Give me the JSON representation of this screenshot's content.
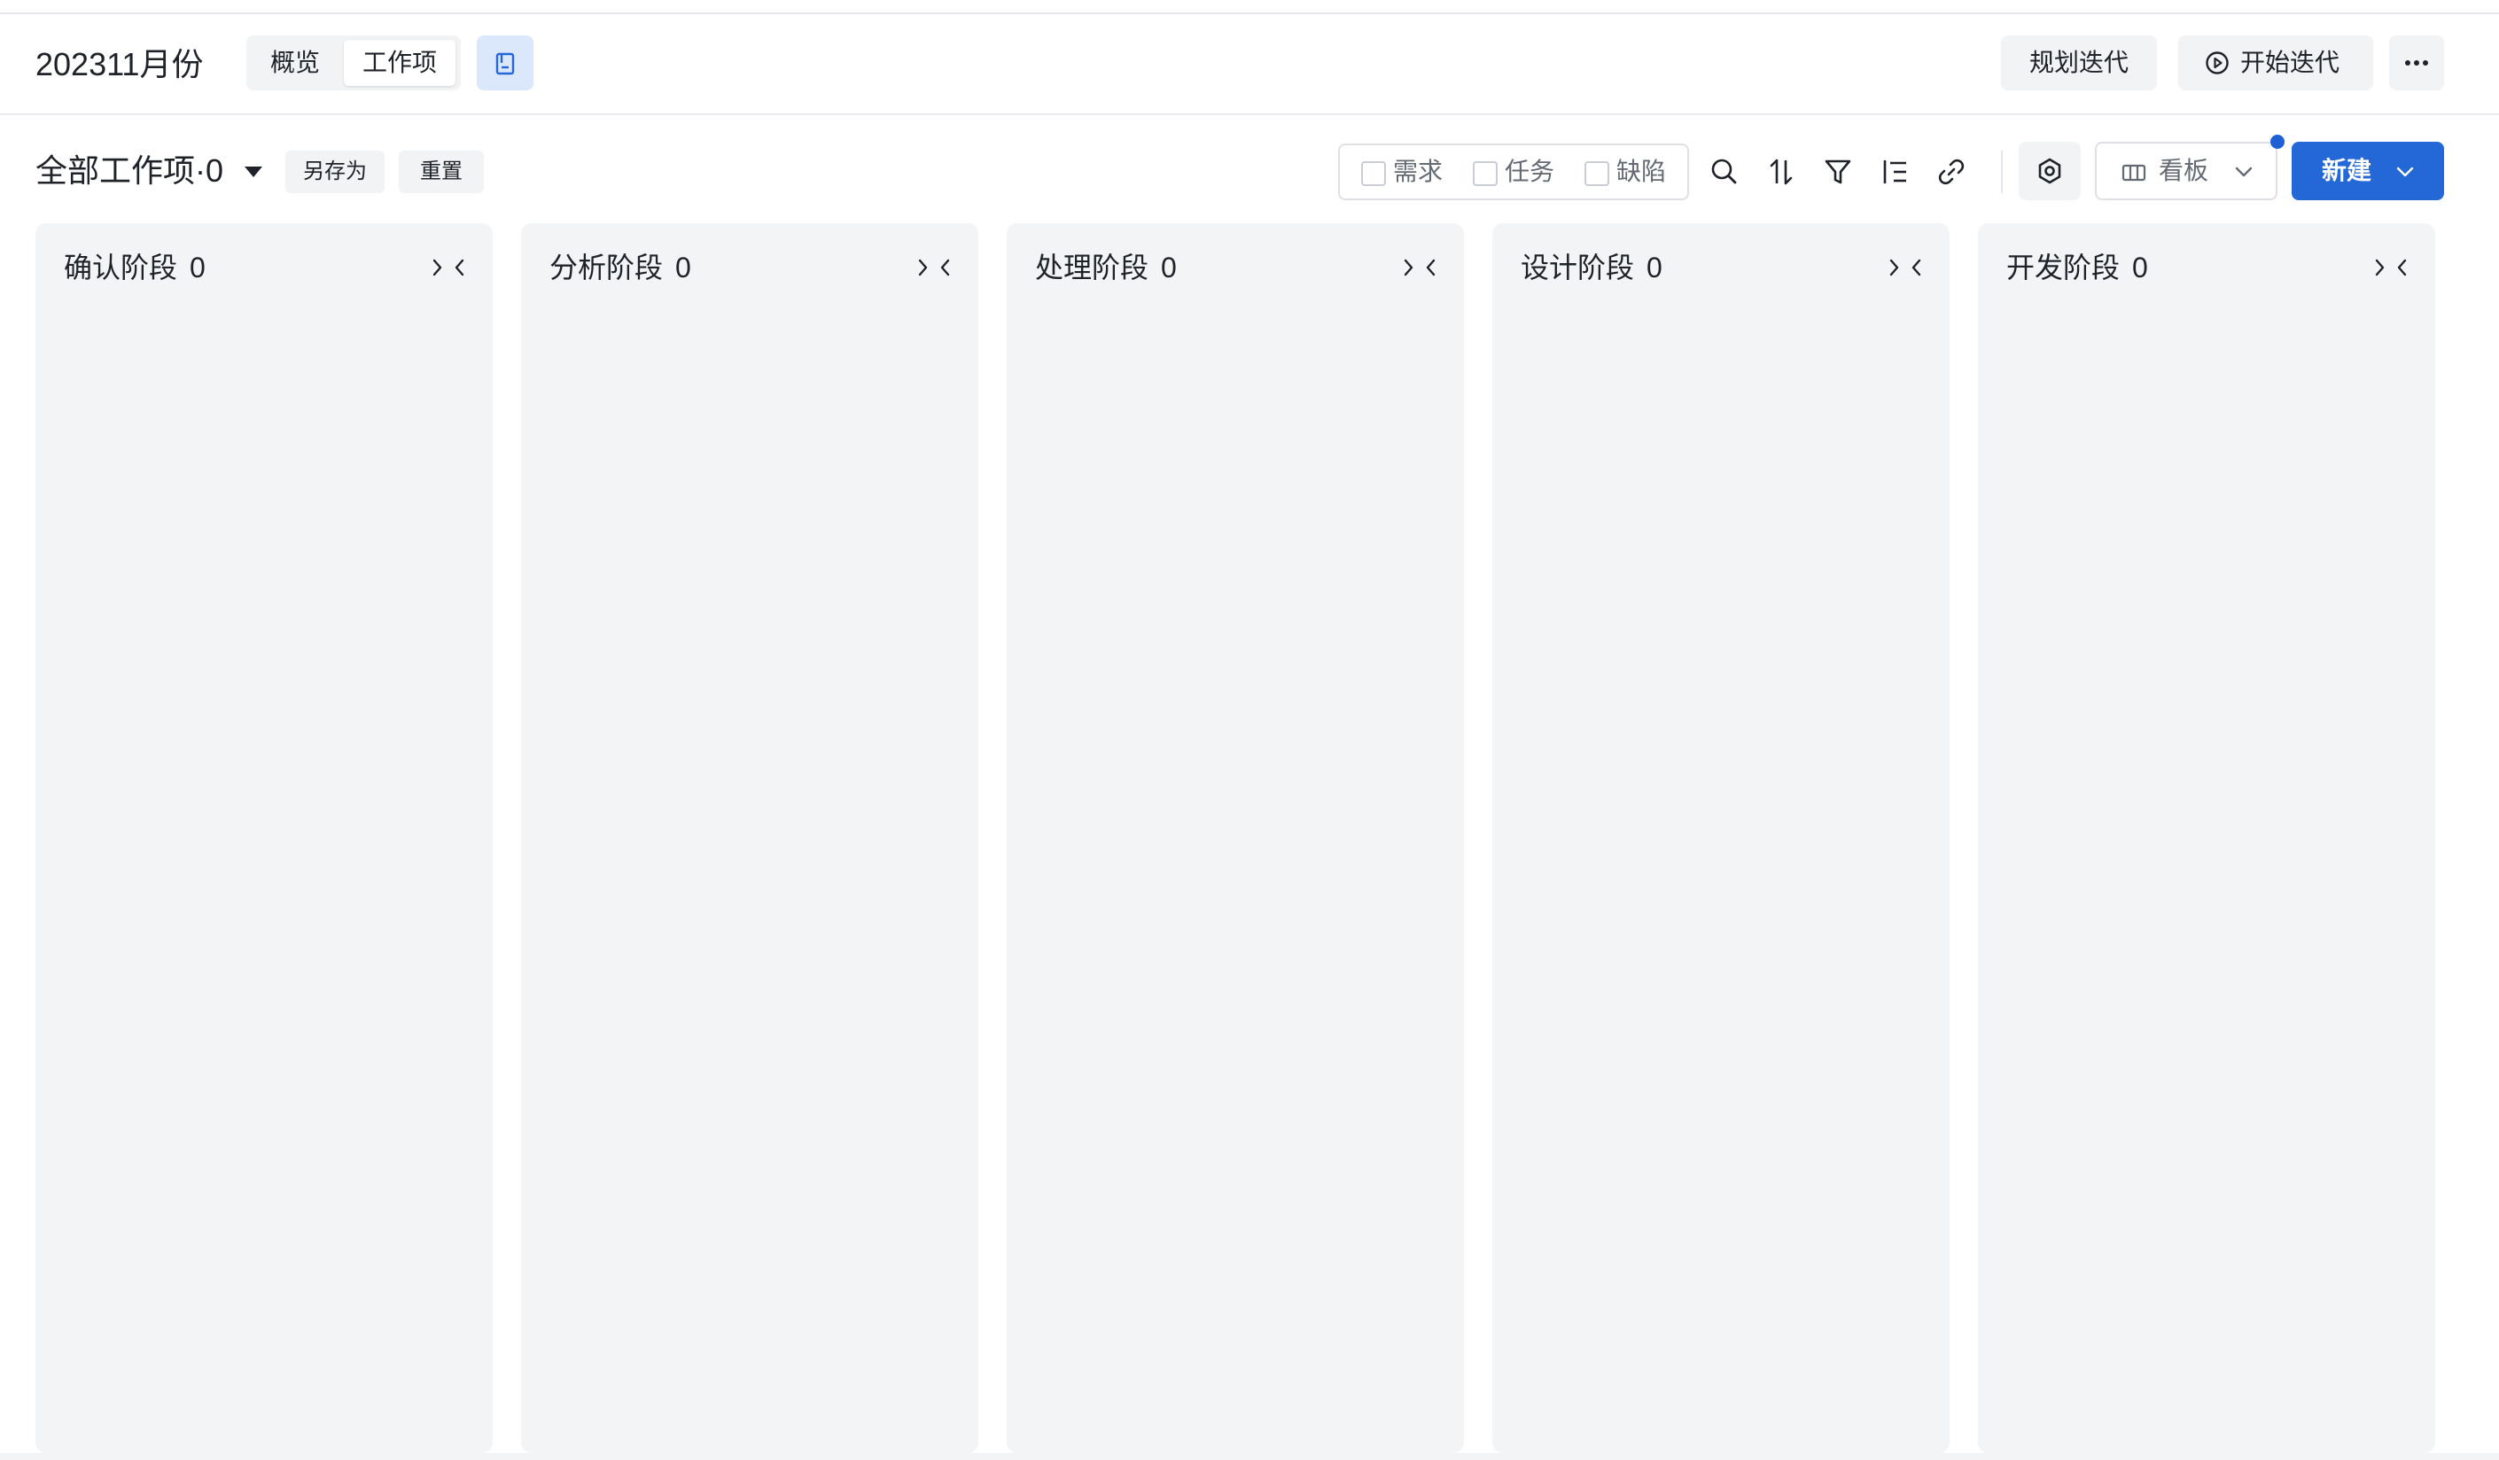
{
  "header": {
    "iteration_title": "202311月份",
    "tabs": [
      {
        "label": "概览",
        "active": false
      },
      {
        "label": "工作项",
        "active": true
      }
    ],
    "doc_icon": "document-icon",
    "plan_button": "规划迭代",
    "start_button": "开始迭代",
    "more_button": "more-horizontal-icon"
  },
  "toolbar": {
    "view_title": "全部工作项·0",
    "save_as": "另存为",
    "reset": "重置",
    "type_filters": [
      {
        "label": "需求",
        "checked": false
      },
      {
        "label": "任务",
        "checked": false
      },
      {
        "label": "缺陷",
        "checked": false
      }
    ],
    "icons": [
      "search-icon",
      "sort-icon",
      "filter-icon",
      "group-list-icon",
      "link-icon",
      "settings-hex-icon"
    ],
    "view_mode": "看板",
    "new_button": "新建",
    "accent_color": "#2467d6"
  },
  "board": {
    "columns": [
      {
        "title": "确认阶段",
        "count": "0"
      },
      {
        "title": "分析阶段",
        "count": "0"
      },
      {
        "title": "处理阶段",
        "count": "0"
      },
      {
        "title": "设计阶段",
        "count": "0"
      },
      {
        "title": "开发阶段",
        "count": "0"
      }
    ]
  }
}
